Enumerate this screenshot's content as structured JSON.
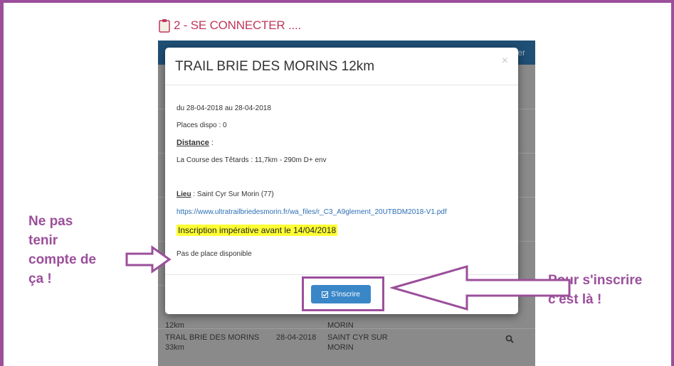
{
  "heading": {
    "text": "2 - SE CONNECTER ...."
  },
  "background_app": {
    "header_fragment": "er",
    "rows": [
      {
        "race": "12km",
        "date": "",
        "place": "MORIN"
      },
      {
        "race": "TRAIL BRIE DES MORINS 33km",
        "date": "28-04-2018",
        "place": "SAINT CYR SUR MORIN"
      }
    ]
  },
  "modal": {
    "title": "TRAIL BRIE DES MORINS 12km",
    "close_glyph": "×",
    "dates": "du 28-04-2018 au 28-04-2018",
    "places": "Places dispo : 0",
    "distance_label": "Distance",
    "distance_suffix": " :",
    "distance_value": "La Course des Têtards : 11,7km - 290m D+ env",
    "lieu_label": "Lieu",
    "lieu_value": " : Saint Cyr Sur Morin (77)",
    "link": "https://www.ultratrailbriedesmorin.fr/wa_files/r_C3_A9glement_20UTBDM2018-V1.pdf",
    "warning": "Inscription impérative avant le 14/04/2018",
    "no_place": "Pas de place disponible",
    "button_label": "S'inscrire"
  },
  "annotations": {
    "left": [
      "Ne pas",
      "tenir",
      "compte de",
      "ça !"
    ],
    "right": [
      "Pour s'inscrire",
      "c'est là !"
    ]
  },
  "colors": {
    "annotation": "#9b4f9b",
    "heading": "#c0365c",
    "button": "#3a87c8",
    "header_bar": "#1f4f74",
    "highlight": "#ffff33"
  }
}
